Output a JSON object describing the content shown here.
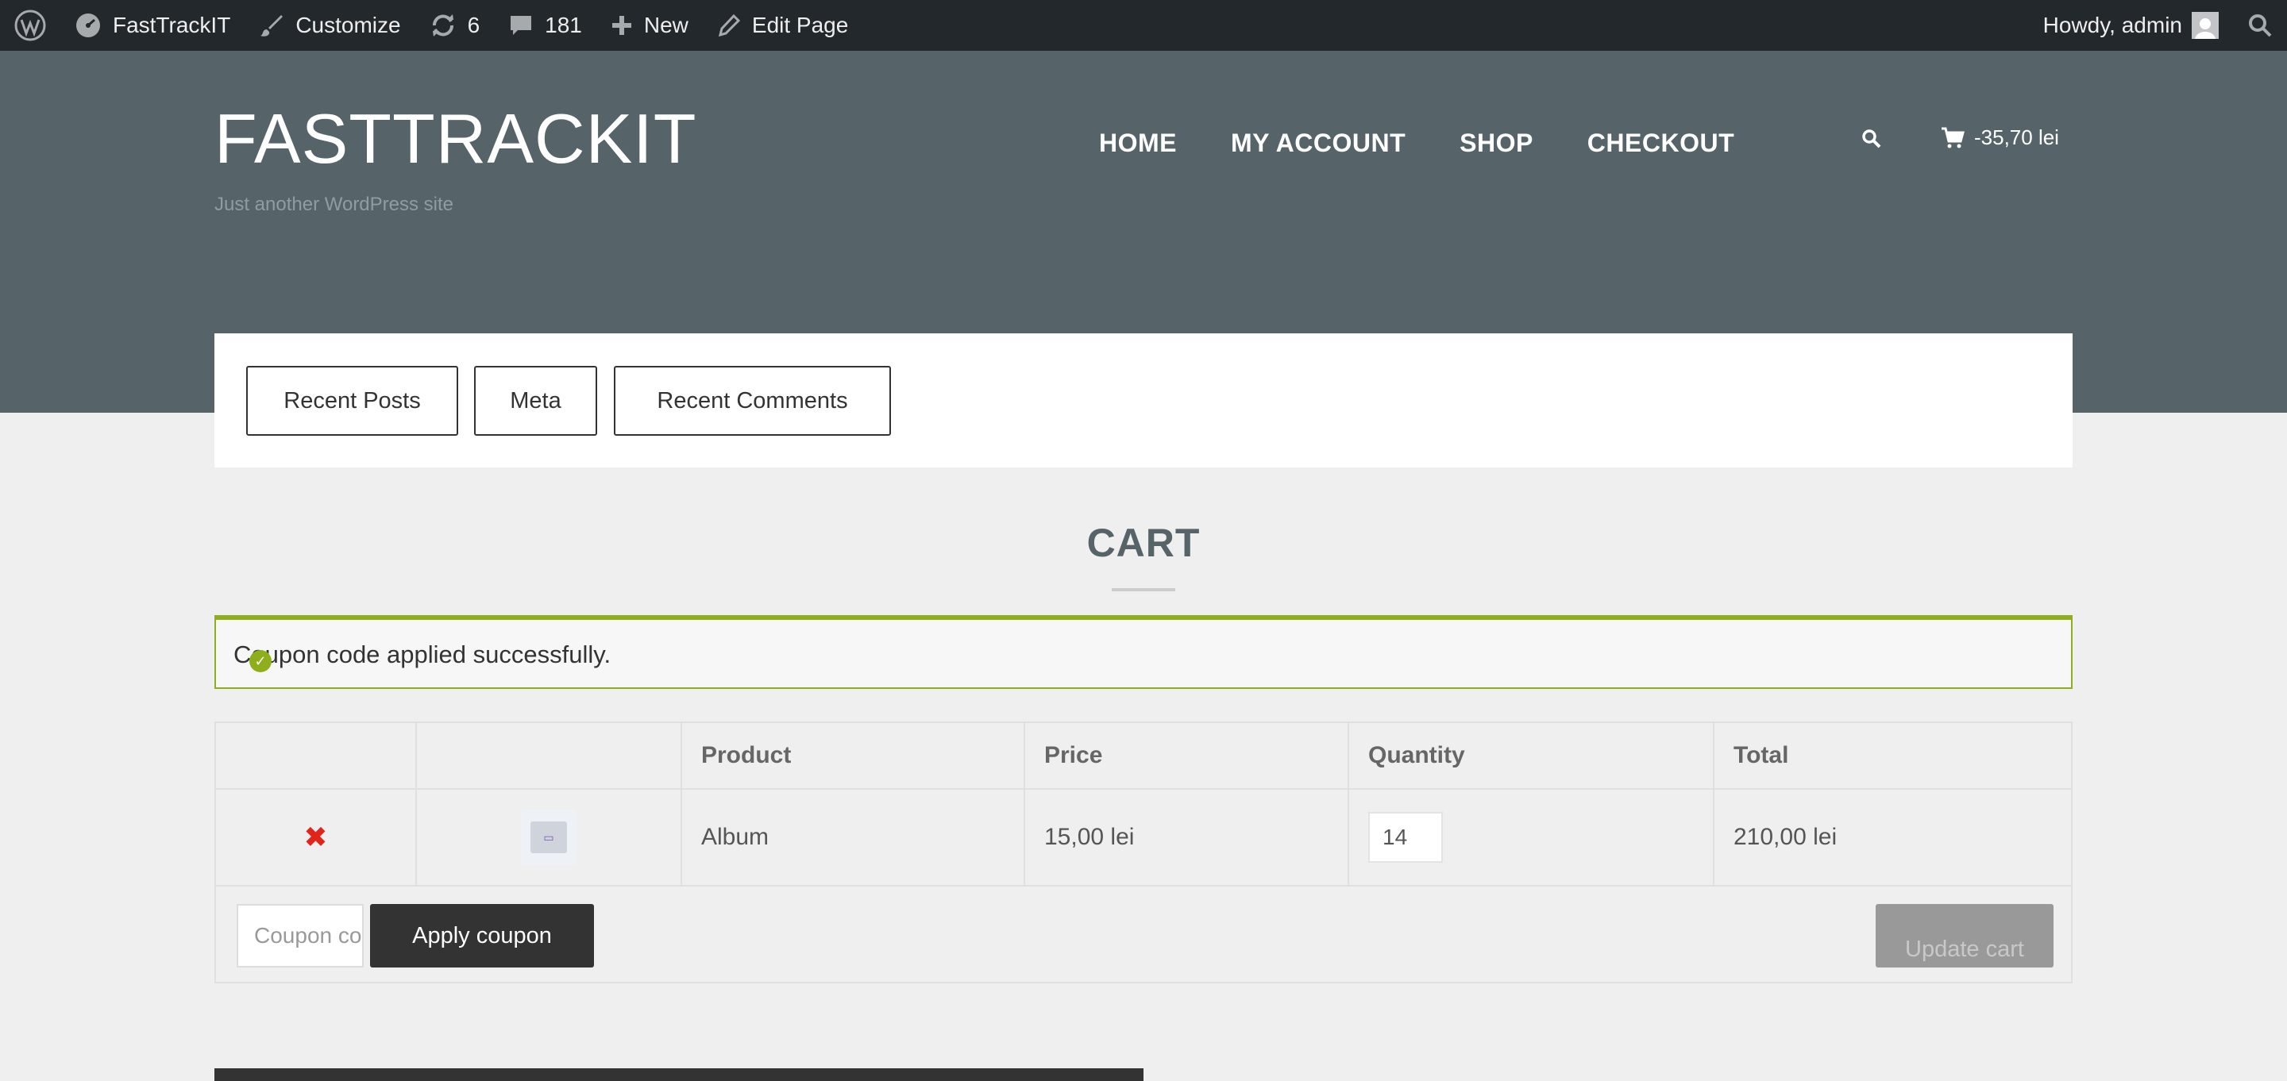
{
  "adminbar": {
    "site_name": "FastTrackIT",
    "customize": "Customize",
    "updates_count": "6",
    "comments_count": "181",
    "new_label": "New",
    "edit_page": "Edit Page",
    "greeting": "Howdy, admin"
  },
  "header": {
    "site_title": "FASTTRACKIT",
    "tagline": "Just another WordPress site",
    "nav": [
      "HOME",
      "MY ACCOUNT",
      "SHOP",
      "CHECKOUT"
    ],
    "cart_total": "-35,70 lei"
  },
  "widgets": {
    "tabs": [
      "Recent Posts",
      "Meta",
      "Recent Comments"
    ]
  },
  "cart": {
    "title": "CART",
    "notice": "Coupon code applied successfully.",
    "columns": [
      "",
      "",
      "Product",
      "Price",
      "Quantity",
      "Total"
    ],
    "items": [
      {
        "remove": "✖",
        "product": "Album",
        "price": "15,00 lei",
        "quantity": "14",
        "total": "210,00 lei"
      }
    ],
    "coupon_placeholder": "Coupon code",
    "apply_label": "Apply coupon",
    "update_label": "Update cart"
  },
  "colors": {
    "admin_bar": "#23282d",
    "header_bg": "#56646a",
    "notice_accent": "#8fae1b",
    "remove_red": "#e2241b"
  }
}
